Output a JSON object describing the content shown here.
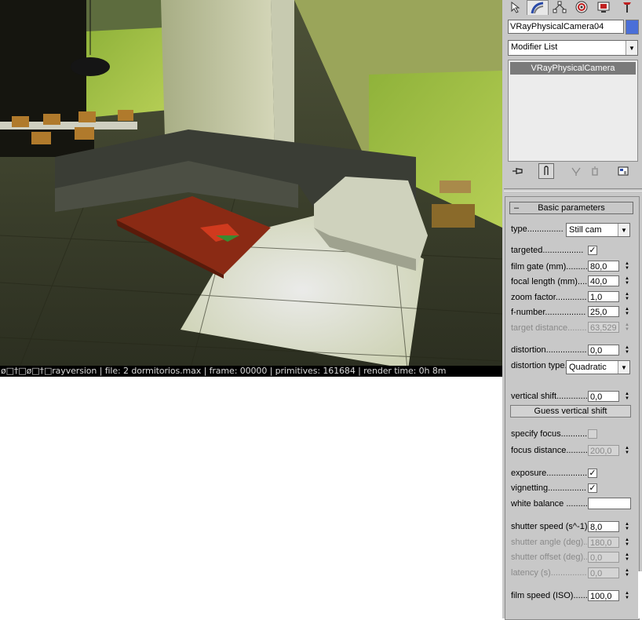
{
  "viewport": {
    "status_text": "ø□†□ø□†□rayversion | file: 2 dormitorios.max | frame: 00000 | primitives: 161684 | render time: 0h 8m"
  },
  "panel": {
    "tabs": [
      {
        "icon": "create-icon"
      },
      {
        "icon": "modify-icon"
      },
      {
        "icon": "hierarchy-icon"
      },
      {
        "icon": "motion-icon"
      },
      {
        "icon": "display-icon"
      },
      {
        "icon": "utilities-icon"
      }
    ],
    "object_name": "VRayPhysicalCamera04",
    "object_color": "#4a6fd8",
    "modifier_list": "Modifier List",
    "stack": [
      "VRayPhysicalCamera"
    ],
    "stack_tools": [
      "pin-stack-icon",
      "show-end-result-icon",
      "make-unique-icon",
      "remove-modifier-icon",
      "configure-modifier-sets-icon"
    ]
  },
  "basic_parameters": {
    "title": "Basic parameters",
    "collapse": "–",
    "type_label": "type...............",
    "type_value": "Still cam",
    "targeted_label": "targeted.................",
    "targeted_checked": true,
    "film_gate_label": "film gate (mm)...........",
    "film_gate_value": "80,0",
    "focal_length_label": "focal length (mm).....",
    "focal_length_value": "40,0",
    "zoom_factor_label": "zoom factor.............",
    "zoom_factor_value": "1,0",
    "f_number_label": "f-number.................",
    "f_number_value": "25,0",
    "target_distance_label": "target distance.........",
    "target_distance_value": "63,529",
    "distortion_label": "distortion..................",
    "distortion_value": "0,0",
    "distortion_type_label": "distortion type.",
    "distortion_type_value": "Quadratic",
    "vertical_shift_label": "vertical shift.............",
    "vertical_shift_value": "0,0",
    "guess_vertical_shift": "Guess vertical shift",
    "specify_focus_label": "specify focus...........",
    "specify_focus_checked": false,
    "focus_distance_label": "focus distance.........",
    "focus_distance_value": "200,0",
    "exposure_label": "exposure..................",
    "exposure_checked": true,
    "vignetting_label": "vignetting.................",
    "vignetting_checked": true,
    "white_balance_label": "white balance .........",
    "white_balance_color": "#ffffff",
    "shutter_speed_label": "shutter speed (s^-1).",
    "shutter_speed_value": "8,0",
    "shutter_angle_label": "shutter angle (deg)..",
    "shutter_angle_value": "180,0",
    "shutter_offset_label": "shutter offset (deg)..",
    "shutter_offset_value": "0,0",
    "latency_label": "latency (s)...................",
    "latency_value": "0,0",
    "film_speed_label": "film speed (ISO).......",
    "film_speed_value": "100,0"
  }
}
